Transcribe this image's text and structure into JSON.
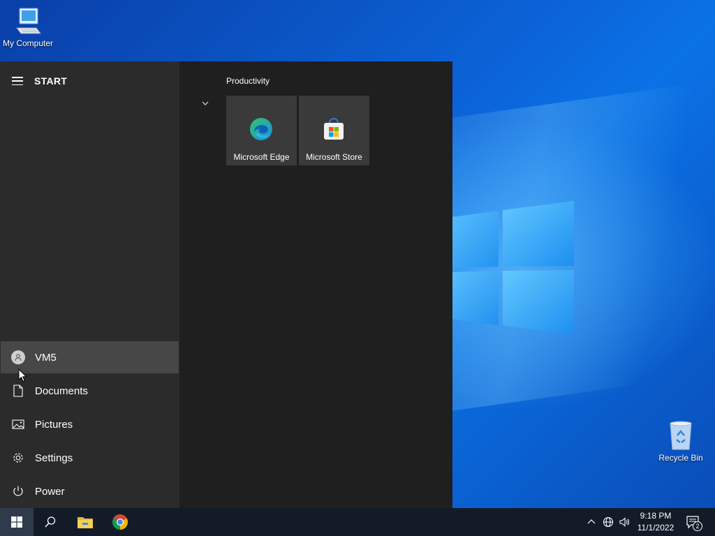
{
  "desktop": {
    "icons": [
      {
        "label": "My Computer",
        "icon": "computer-icon"
      },
      {
        "label": "Recycle Bin",
        "icon": "recycle-bin-icon"
      }
    ]
  },
  "start_menu": {
    "title": "START",
    "group_title": "Productivity",
    "tiles": [
      {
        "label": "Microsoft Edge",
        "icon": "edge-icon"
      },
      {
        "label": "Microsoft Store",
        "icon": "store-icon"
      }
    ],
    "side_items": [
      {
        "label": "VM5",
        "icon": "user-icon"
      },
      {
        "label": "Documents",
        "icon": "document-icon"
      },
      {
        "label": "Pictures",
        "icon": "pictures-icon"
      },
      {
        "label": "Settings",
        "icon": "gear-icon"
      },
      {
        "label": "Power",
        "icon": "power-icon"
      }
    ]
  },
  "taskbar": {
    "pinned": [
      {
        "icon": "search-icon"
      },
      {
        "icon": "file-explorer-icon"
      },
      {
        "icon": "chrome-icon"
      }
    ],
    "clock": {
      "time": "9:18 PM",
      "date": "11/1/2022"
    },
    "notification_count": "2"
  },
  "colors": {
    "accent": "#0a62d6",
    "start_bg": "#1f1f1f",
    "sidebar_bg": "#2b2b2b",
    "taskbar_bg": "#121b27"
  }
}
